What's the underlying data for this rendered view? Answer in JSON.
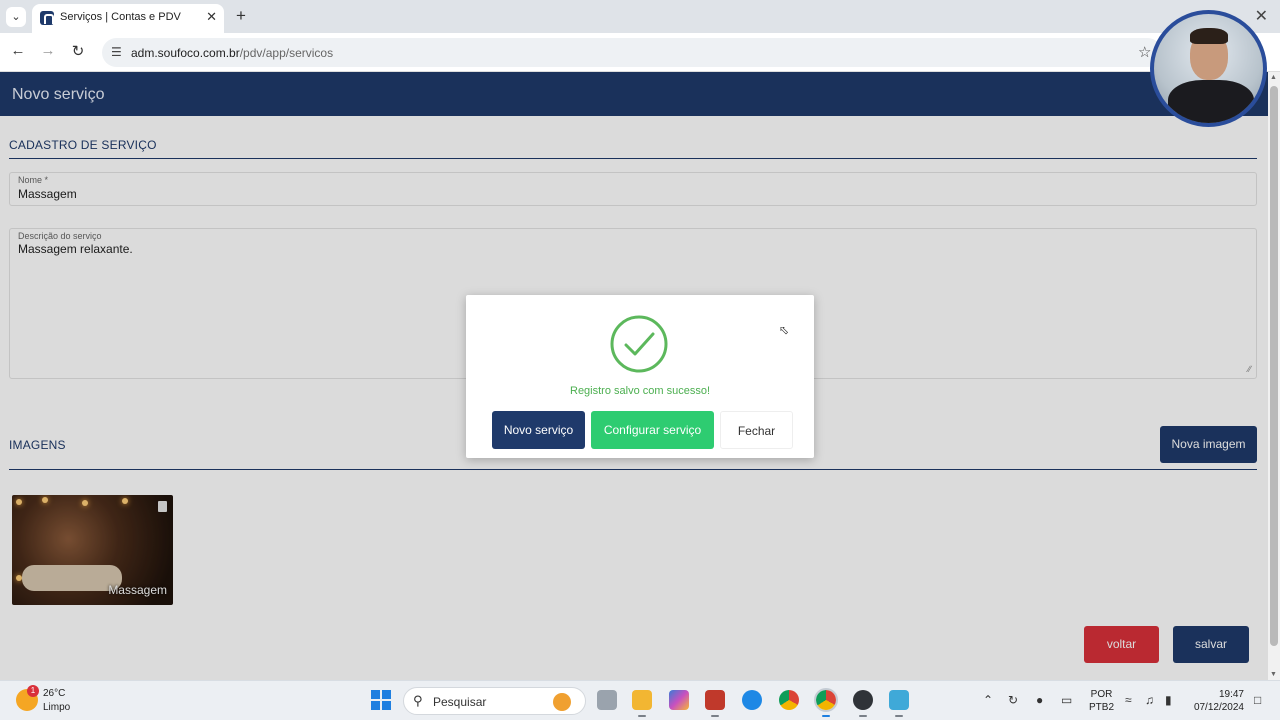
{
  "browser": {
    "tab_title": "Serviços | Contas e PDV",
    "url_host": "adm.soufoco.com.br",
    "url_path": "/pdv/app/servicos",
    "icons": [
      "chevron-down-icon",
      "close-icon",
      "plus-icon",
      "back-icon",
      "forward-icon",
      "reload-icon",
      "site-settings-icon",
      "star-icon"
    ]
  },
  "page": {
    "title": "Novo serviço",
    "section_cadastro": "CADASTRO DE SERVIÇO",
    "nome_label": "Nome *",
    "nome_value": "Massagem",
    "descricao_label": "Descrição do serviço",
    "descricao_value": "Massagem relaxante.",
    "section_imagens": "IMAGENS",
    "nova_imagem_label": "Nova imagem",
    "image_caption": "Massagem",
    "voltar_label": "voltar",
    "salvar_label": "salvar"
  },
  "modal": {
    "message": "Registro salvo com sucesso!",
    "novo_servico_label": "Novo serviço",
    "configurar_servico_label": "Configurar serviço",
    "fechar_label": "Fechar"
  },
  "taskbar": {
    "weather_temp": "26°C",
    "weather_condition": "Limpo",
    "weather_badge": "1",
    "search_placeholder": "Pesquisar",
    "lang_line1": "POR",
    "lang_line2": "PTB2",
    "time": "19:47",
    "date": "07/12/2024"
  },
  "colors": {
    "primary": "#1f3a6b",
    "success": "#2ecc71",
    "danger": "#d9303a"
  }
}
